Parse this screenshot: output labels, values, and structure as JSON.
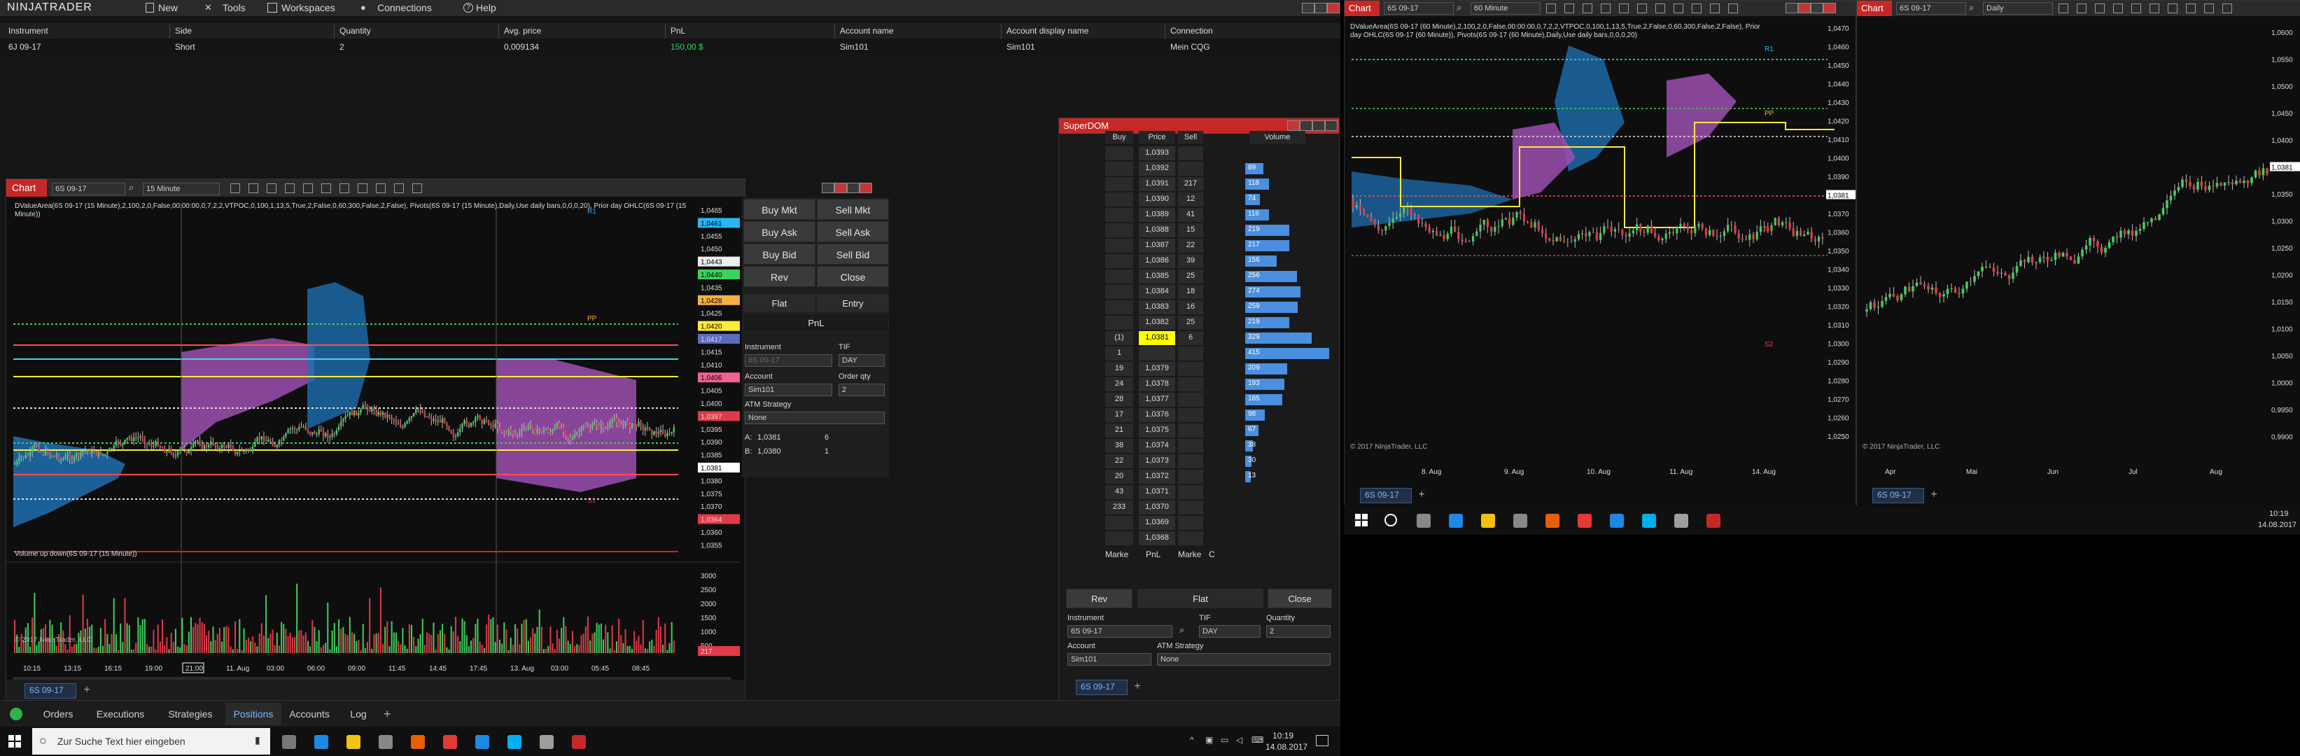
{
  "menu": {
    "logo": "NINJATRADER",
    "items": [
      "New",
      "Tools",
      "Workspaces",
      "Connections",
      "Help"
    ]
  },
  "positions": {
    "headers": [
      "Instrument",
      "Side",
      "Quantity",
      "Avg. price",
      "PnL",
      "Account name",
      "Account display name",
      "Connection"
    ],
    "row": [
      "6J 09-17",
      "Short",
      "2",
      "0,009134",
      "150,00 $",
      "Sim101",
      "Sim101",
      "Mein CQG"
    ]
  },
  "chart1": {
    "tab": "Chart",
    "instrument": "6S 09-17",
    "interval": "15 Minute",
    "study_text": "DValueArea(6S 09-17 (15 Minute),2,100,2,0,False,00:00:00,0,7,2,2,VTPOC,0,100,1,13,5,True,2,False,0,60,300,False,2,False), Pivots(6S 09-17 (15 Minute),Daily,Use daily bars,0,0,0,20), Prior day OHLC(6S 09-17 (15 Minute))",
    "volume_label": "Volume up down(6S 09-17 (15 Minute))",
    "copyright": "© 2017 NinjaTrader, LLC",
    "price_labels": [
      "1,0465",
      "1,0461",
      "1,0455",
      "1,0450",
      "1,0443",
      "1,0440",
      "1,0435",
      "1,0428",
      "1,0425",
      "1,0420",
      "1,0417",
      "1,0415",
      "1,0410",
      "1,0406",
      "1,0405",
      "1,0400",
      "1,0397",
      "1,0395",
      "1,0390",
      "1,0385",
      "1,0381",
      "1,0380",
      "1,0375",
      "1,0370",
      "1,0364",
      "1,0360",
      "1,0355"
    ],
    "volume_labels": [
      "3000",
      "2500",
      "2000",
      "1500",
      "1000",
      "500",
      "217"
    ],
    "time_labels": [
      "10:15",
      "13:15",
      "16:15",
      "19:00",
      "21:00",
      "11. Aug",
      "03:00",
      "06:00",
      "09:00",
      "11:45",
      "14:45",
      "17:45",
      "13. Aug",
      "03:00",
      "05:45",
      "08:45"
    ],
    "pivot_labels": [
      "R1",
      "PP",
      "S1"
    ],
    "footer_tab": "6S 09-17",
    "order_entry": {
      "buy_mkt": "Buy Mkt",
      "sell_mkt": "Sell Mkt",
      "buy_ask": "Buy Ask",
      "sell_ask": "Sell Ask",
      "buy_bid": "Buy Bid",
      "sell_bid": "Sell Bid",
      "rev": "Rev",
      "close": "Close",
      "flat": "Flat",
      "entry": "Entry",
      "pnl": "PnL",
      "instrument_label": "Instrument",
      "instrument_value": "6S 09-17",
      "tif_label": "TIF",
      "tif_value": "DAY",
      "account_label": "Account",
      "account_value": "Sim101",
      "qty_label": "Order qty",
      "qty_value": "2",
      "atm_label": "ATM Strategy",
      "atm_value": "None",
      "a_label": "A:",
      "a_price": "1,0381",
      "a_size": "6",
      "b_label": "B:",
      "b_price": "1,0380",
      "b_size": "1"
    }
  },
  "superdom": {
    "title": "SuperDOM",
    "headers": [
      "Buy",
      "Price",
      "Sell",
      "Volume"
    ],
    "rows": [
      {
        "buy": "",
        "price": "1,0393",
        "sell": "",
        "vol": ""
      },
      {
        "buy": "",
        "price": "1,0392",
        "sell": "",
        "vol": "89"
      },
      {
        "buy": "",
        "price": "1,0391",
        "sell": "217",
        "vol": "118"
      },
      {
        "buy": "",
        "price": "1,0390",
        "sell": "12",
        "vol": "74"
      },
      {
        "buy": "",
        "price": "1,0389",
        "sell": "41",
        "vol": "116"
      },
      {
        "buy": "",
        "price": "1,0388",
        "sell": "15",
        "vol": "219"
      },
      {
        "buy": "",
        "price": "1,0387",
        "sell": "22",
        "vol": "217"
      },
      {
        "buy": "",
        "price": "1,0386",
        "sell": "39",
        "vol": "156"
      },
      {
        "buy": "",
        "price": "1,0385",
        "sell": "25",
        "vol": "256"
      },
      {
        "buy": "",
        "price": "1,0384",
        "sell": "18",
        "vol": "274"
      },
      {
        "buy": "",
        "price": "1,0383",
        "sell": "16",
        "vol": "259"
      },
      {
        "buy": "",
        "price": "1,0382",
        "sell": "25",
        "vol": "219"
      },
      {
        "buy": "(1)",
        "price": "1,0381",
        "sell": "6",
        "vol": "329"
      },
      {
        "buy": "1",
        "price": "",
        "sell": "",
        "vol": "415"
      },
      {
        "buy": "19",
        "price": "1,0379",
        "sell": "",
        "vol": "209"
      },
      {
        "buy": "24",
        "price": "1,0378",
        "sell": "",
        "vol": "193"
      },
      {
        "buy": "28",
        "price": "1,0377",
        "sell": "",
        "vol": "185"
      },
      {
        "buy": "17",
        "price": "1,0376",
        "sell": "",
        "vol": "98"
      },
      {
        "buy": "21",
        "price": "1,0375",
        "sell": "",
        "vol": "67"
      },
      {
        "buy": "38",
        "price": "1,0374",
        "sell": "",
        "vol": "38"
      },
      {
        "buy": "22",
        "price": "1,0373",
        "sell": "",
        "vol": "30"
      },
      {
        "buy": "20",
        "price": "1,0372",
        "sell": "",
        "vol": "13"
      },
      {
        "buy": "43",
        "price": "1,0371",
        "sell": "",
        "vol": ""
      },
      {
        "buy": "233",
        "price": "1,0370",
        "sell": "",
        "vol": ""
      },
      {
        "buy": "",
        "price": "1,0369",
        "sell": "",
        "vol": ""
      },
      {
        "buy": "",
        "price": "1,0368",
        "sell": "",
        "vol": ""
      }
    ],
    "footer": {
      "marke_left": "Marke",
      "pnl": "PnL",
      "marke_right": "Marke",
      "c": "C"
    },
    "rev": "Rev",
    "flat": "Flat",
    "close": "Close",
    "instrument_label": "Instrument",
    "instrument_value": "6S 09-17",
    "tif_label": "TIF",
    "tif_value": "DAY",
    "qty_label": "Quantity",
    "qty_value": "2",
    "account_label": "Account",
    "account_value": "Sim101",
    "atm_label": "ATM Strategy",
    "atm_value": "None",
    "footer_tab": "6S 09-17"
  },
  "chart2": {
    "tab": "Chart",
    "instrument": "6S 09-17",
    "interval": "60 Minute",
    "study_text": "DValueArea(6S 09-17 (60 Minute),2,100,2,0,False,00:00:00,0,7,2,2,VTPOC,0,100,1,13,5,True,2,False,0,60,300,False,2,False), Prior day OHLC(6S 09-17 (60 Minute)), Pivots(6S 09-17 (60 Minute),Daily,Use daily bars,0,0,0,20)",
    "copyright": "© 2017 NinjaTrader, LLC",
    "price_labels": [
      "1,0470",
      "1,0460",
      "1,0450",
      "1,0440",
      "1,0430",
      "1,0420",
      "1,0410",
      "1,0400",
      "1,0390",
      "1,0381",
      "1,0370",
      "1,0360",
      "1,0350",
      "1,0340",
      "1,0330",
      "1,0320",
      "1,0310",
      "1,0300",
      "1,0290",
      "1,0280",
      "1,0270",
      "1,0260",
      "1,0250"
    ],
    "time_labels": [
      "8. Aug",
      "9. Aug",
      "10. Aug",
      "11. Aug",
      "14. Aug"
    ],
    "pivot_labels": [
      "R1",
      "PP",
      "S1",
      "S2"
    ],
    "footer_tab": "6S 09-17"
  },
  "chart3": {
    "tab": "Chart",
    "instrument": "6S 09-17",
    "interval": "Daily",
    "copyright": "© 2017 NinjaTrader, LLC",
    "price_labels": [
      "1,0600",
      "1,0550",
      "1,0500",
      "1,0450",
      "1,0400",
      "1,0381",
      "1,0350",
      "1,0300",
      "1,0250",
      "1,0200",
      "1,0150",
      "1,0100",
      "1,0050",
      "1,0000",
      "0,9950",
      "0,9900"
    ],
    "time_labels": [
      "Apr",
      "Mai",
      "Jun",
      "Jul",
      "Aug"
    ],
    "footer_tab": "6S 09-17"
  },
  "control_tabs": [
    "Orders",
    "Executions",
    "Strategies",
    "Positions",
    "Accounts",
    "Log"
  ],
  "taskbar": {
    "search_placeholder": "Zur Suche Text hier eingeben",
    "time": "10:19",
    "date": "14.08.2017"
  },
  "taskbar2": {
    "time": "10:19",
    "date": "14.08.2017"
  },
  "colors": {
    "accent": "#c62828",
    "buy": "#3a9bdc",
    "sell": "#e03a48",
    "poc_magenta": "#b05bc0",
    "vol_blue": "#1e6fb0",
    "highlight_yellow": "#ffff00"
  }
}
